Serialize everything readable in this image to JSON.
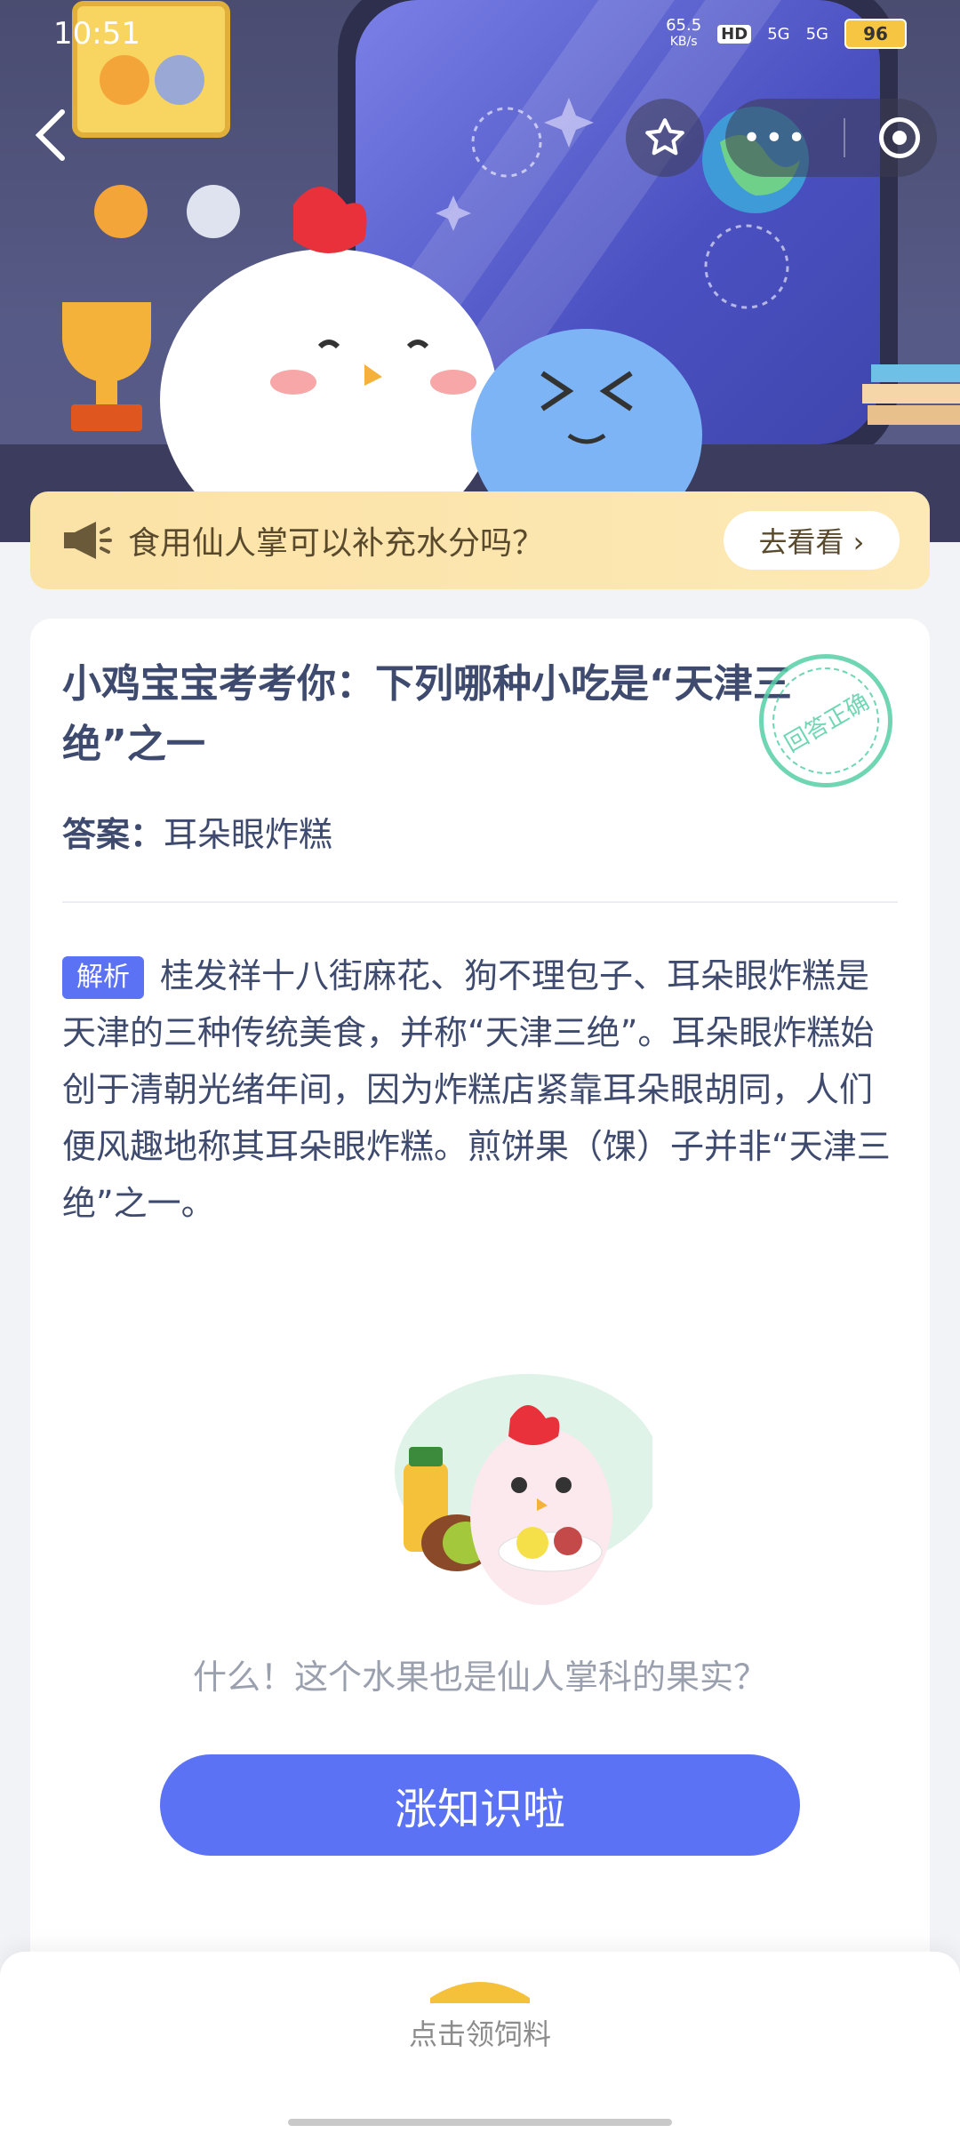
{
  "status_bar": {
    "time": "10:51",
    "net_speed": "65.5",
    "net_unit": "KB/s",
    "hd_label": "HD",
    "sim1": "5G",
    "sim2": "5G",
    "battery": "96"
  },
  "tip": {
    "icon": "megaphone-icon",
    "text": "食用仙人掌可以补充水分吗？",
    "button_label": "去看看 ›"
  },
  "question": {
    "title": "小鸡宝宝考考你：下列哪种小吃是“天津三绝”之一",
    "stamp": "回答正确"
  },
  "answer": {
    "label": "答案：",
    "value": "耳朵眼炸糕"
  },
  "analysis": {
    "tag": "解析",
    "text": "桂发祥十八街麻花、狗不理包子、耳朵眼炸糕是天津的三种传统美食，并称“天津三绝”。耳朵眼炸糕始创于清朝光绪年间，因为炸糕店紧靠耳朵眼胡同，人们便风趣地称其耳朵眼炸糕。煎饼果（馃）子并非“天津三绝”之一。"
  },
  "fun_fact": {
    "text": "什么！这个水果也是仙人掌科的果实？",
    "button_label": "涨知识啦"
  },
  "bottom": {
    "label": "点击领饲料"
  },
  "colors": {
    "accent": "#5b72f5",
    "tip_bg": "#fde9b6",
    "stamp": "#56cfa6",
    "text_primary": "#3e4a6e"
  }
}
